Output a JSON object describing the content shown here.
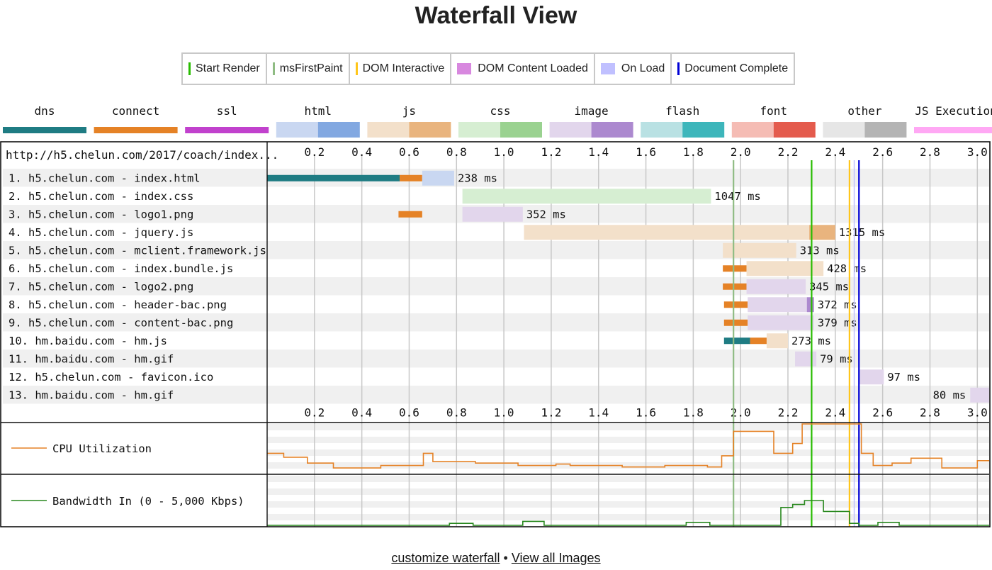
{
  "page": {
    "title": "Waterfall View",
    "footer": {
      "customize_label": "customize waterfall",
      "separator": "•",
      "images_label": "View all Images"
    }
  },
  "legend": [
    {
      "label": "Start Render",
      "kind": "line",
      "color": "#28bc00"
    },
    {
      "label": "msFirstPaint",
      "kind": "line",
      "color": "#8fbc83"
    },
    {
      "label": "DOM Interactive",
      "kind": "line",
      "color": "#ffc61a"
    },
    {
      "label": "DOM Content Loaded",
      "kind": "square",
      "color": "#d888df"
    },
    {
      "label": "On Load",
      "kind": "square",
      "color": "#c0c0ff"
    },
    {
      "label": "Document Complete",
      "kind": "line",
      "color": "#0000d6"
    }
  ],
  "content_types": [
    {
      "name": "dns",
      "colors": [
        "#1f7c83"
      ],
      "style": "solid"
    },
    {
      "name": "connect",
      "colors": [
        "#e58226"
      ],
      "style": "solid"
    },
    {
      "name": "ssl",
      "colors": [
        "#c141cd"
      ],
      "style": "solid"
    },
    {
      "name": "html",
      "colors": [
        "#c9d7f1",
        "#82a8e1"
      ],
      "style": "split"
    },
    {
      "name": "js",
      "colors": [
        "#f3e0ca",
        "#e9b47e"
      ],
      "style": "split"
    },
    {
      "name": "css",
      "colors": [
        "#d6eed2",
        "#9ad290"
      ],
      "style": "split"
    },
    {
      "name": "image",
      "colors": [
        "#e2d6ec",
        "#ac89cf"
      ],
      "style": "split"
    },
    {
      "name": "flash",
      "colors": [
        "#b9e1e3",
        "#3db6bb"
      ],
      "style": "split"
    },
    {
      "name": "font",
      "colors": [
        "#f5bcb4",
        "#e45b4d"
      ],
      "style": "split"
    },
    {
      "name": "other",
      "colors": [
        "#e6e6e6",
        "#b4b4b4"
      ],
      "style": "split"
    },
    {
      "name": "JS Execution",
      "colors": [
        "#ffa8f4"
      ],
      "style": "thin"
    }
  ],
  "chart_data": {
    "type": "waterfall",
    "url_header": "http://h5.chelun.com/2017/coach/index...",
    "x_unit": "seconds",
    "xlim": [
      0,
      3.05
    ],
    "x_ticks": [
      0.2,
      0.4,
      0.6,
      0.8,
      1.0,
      1.2,
      1.4,
      1.6,
      1.8,
      2.0,
      2.2,
      2.4,
      2.6,
      2.8,
      3.0
    ],
    "x_tick_labels": [
      "0.2",
      "0.4",
      "0.6",
      "0.8",
      "1.0",
      "1.2",
      "1.4",
      "1.6",
      "1.8",
      "2.0",
      "2.2",
      "2.4",
      "2.6",
      "2.8",
      "3.0"
    ],
    "markers": [
      {
        "name": "msFirstPaint",
        "time": 1.97,
        "color": "#8fbc83"
      },
      {
        "name": "Start Render",
        "time": 2.3,
        "color": "#28bc00"
      },
      {
        "name": "DOM Interactive",
        "time": 2.46,
        "color": "#ffc61a"
      },
      {
        "name": "On Load",
        "time": 2.48,
        "color": "#c0c0ff"
      },
      {
        "name": "Document Complete",
        "time": 2.5,
        "color": "#0000d6"
      }
    ],
    "requests": [
      {
        "label": "1. h5.chelun.com - index.html",
        "type": "html",
        "dns": [
          0.0,
          0.56
        ],
        "connect": [
          0.56,
          0.655
        ],
        "ttfb": [
          0.655,
          0.79
        ],
        "download": null,
        "duration": "238 ms"
      },
      {
        "label": "2. h5.chelun.com - index.css",
        "type": "css",
        "dns": null,
        "connect": null,
        "ttfb": [
          0.825,
          1.875
        ],
        "download": null,
        "duration": "1047 ms"
      },
      {
        "label": "3. h5.chelun.com - logo1.png",
        "type": "image",
        "dns": null,
        "connect": [
          0.555,
          0.655
        ],
        "ttfb": [
          0.825,
          1.08
        ],
        "download": null,
        "duration": "352 ms"
      },
      {
        "label": "4. h5.chelun.com - jquery.js",
        "type": "js",
        "dns": null,
        "connect": null,
        "ttfb": [
          1.085,
          2.29
        ],
        "download": [
          2.29,
          2.4
        ],
        "duration": "1315 ms"
      },
      {
        "label": "5. h5.chelun.com - mclient.framework.js",
        "type": "js",
        "dns": null,
        "connect": null,
        "ttfb": [
          1.925,
          2.235
        ],
        "download": null,
        "duration": "313 ms"
      },
      {
        "label": "6. h5.chelun.com - index.bundle.js",
        "type": "js",
        "dns": null,
        "connect": [
          1.925,
          2.025
        ],
        "ttfb": [
          2.025,
          2.35
        ],
        "download": null,
        "duration": "428 ms"
      },
      {
        "label": "7. h5.chelun.com - logo2.png",
        "type": "image",
        "dns": null,
        "connect": [
          1.925,
          2.025
        ],
        "ttfb": [
          2.025,
          2.275
        ],
        "download": null,
        "duration": "345 ms"
      },
      {
        "label": "8. h5.chelun.com - header-bac.png",
        "type": "image",
        "dns": null,
        "connect": [
          1.93,
          2.03
        ],
        "ttfb": [
          2.03,
          2.28
        ],
        "download": [
          2.28,
          2.31
        ],
        "duration": "372 ms"
      },
      {
        "label": "9. h5.chelun.com - content-bac.png",
        "type": "image",
        "dns": null,
        "connect": [
          1.93,
          2.03
        ],
        "ttfb": [
          2.03,
          2.31
        ],
        "download": null,
        "duration": "379 ms"
      },
      {
        "label": "10. hm.baidu.com - hm.js",
        "type": "js",
        "dns": [
          1.93,
          2.04
        ],
        "connect": [
          2.04,
          2.11
        ],
        "ttfb": [
          2.11,
          2.2
        ],
        "download": null,
        "duration": "273 ms"
      },
      {
        "label": "11. hm.baidu.com - hm.gif",
        "type": "image",
        "dns": null,
        "connect": null,
        "ttfb": [
          2.23,
          2.32
        ],
        "download": null,
        "duration": "79 ms"
      },
      {
        "label": "12. h5.chelun.com - favicon.ico",
        "type": "image",
        "dns": null,
        "connect": null,
        "ttfb": [
          2.5,
          2.605
        ],
        "download": null,
        "duration": "97 ms"
      },
      {
        "label": "13. hm.baidu.com - hm.gif",
        "type": "image",
        "dns": null,
        "connect": null,
        "ttfb": [
          2.97,
          3.05
        ],
        "download": null,
        "duration": "80 ms"
      }
    ],
    "cpu": {
      "label": "CPU Utilization",
      "color": "#e58226",
      "ylim": [
        0,
        100
      ],
      "points": [
        [
          0.0,
          40
        ],
        [
          0.07,
          32
        ],
        [
          0.17,
          20
        ],
        [
          0.28,
          10
        ],
        [
          0.35,
          10
        ],
        [
          0.47,
          10
        ],
        [
          0.48,
          15
        ],
        [
          0.56,
          15
        ],
        [
          0.64,
          15
        ],
        [
          0.66,
          40
        ],
        [
          0.7,
          23
        ],
        [
          0.72,
          23
        ],
        [
          0.88,
          20
        ],
        [
          0.96,
          20
        ],
        [
          1.06,
          15
        ],
        [
          1.22,
          18
        ],
        [
          1.28,
          15
        ],
        [
          1.4,
          15
        ],
        [
          1.46,
          15
        ],
        [
          1.5,
          12
        ],
        [
          1.56,
          12
        ],
        [
          1.64,
          12
        ],
        [
          1.68,
          15
        ],
        [
          1.74,
          15
        ],
        [
          1.8,
          15
        ],
        [
          1.86,
          12
        ],
        [
          1.92,
          35
        ],
        [
          1.97,
          85
        ],
        [
          2.06,
          85
        ],
        [
          2.14,
          40
        ],
        [
          2.22,
          60
        ],
        [
          2.26,
          100
        ],
        [
          2.46,
          100
        ],
        [
          2.48,
          100
        ],
        [
          2.51,
          40
        ],
        [
          2.56,
          15
        ],
        [
          2.64,
          20
        ],
        [
          2.72,
          30
        ],
        [
          2.85,
          10
        ],
        [
          2.93,
          10
        ],
        [
          3.0,
          25
        ],
        [
          3.05,
          25
        ]
      ]
    },
    "bandwidth": {
      "label": "Bandwidth In (0 - 5,000 Kbps)",
      "color": "#28881e",
      "ylim": [
        0,
        5000
      ],
      "points": [
        [
          0.0,
          0
        ],
        [
          0.76,
          0
        ],
        [
          0.77,
          200
        ],
        [
          0.86,
          200
        ],
        [
          0.87,
          0
        ],
        [
          1.07,
          0
        ],
        [
          1.08,
          400
        ],
        [
          1.16,
          400
        ],
        [
          1.17,
          0
        ],
        [
          1.76,
          0
        ],
        [
          1.77,
          300
        ],
        [
          1.86,
          300
        ],
        [
          1.87,
          0
        ],
        [
          2.16,
          0
        ],
        [
          2.17,
          1800
        ],
        [
          2.22,
          2100
        ],
        [
          2.27,
          2500
        ],
        [
          2.32,
          2500
        ],
        [
          2.35,
          1400
        ],
        [
          2.46,
          200
        ],
        [
          2.5,
          0
        ],
        [
          2.57,
          0
        ],
        [
          2.58,
          300
        ],
        [
          2.66,
          300
        ],
        [
          2.67,
          0
        ],
        [
          3.05,
          0
        ]
      ]
    }
  }
}
